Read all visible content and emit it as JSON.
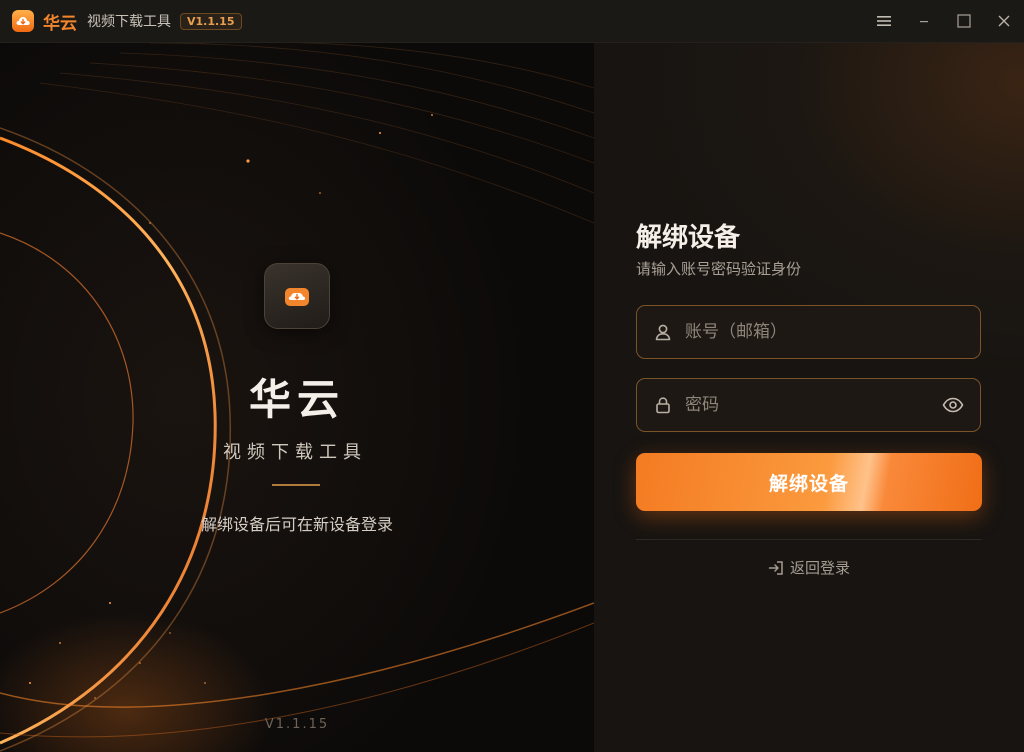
{
  "titlebar": {
    "brand": "华云",
    "subtitle": "视频下载工具",
    "version": "V1.1.15",
    "icons": {
      "app": "cloud-download-icon",
      "menu": "menu-icon",
      "minimize": "minimize-icon",
      "maximize": "maximize-icon",
      "close": "close-icon"
    }
  },
  "hero": {
    "title": "华云",
    "subtitle": "视频下载工具",
    "description": "解绑设备后可在新设备登录",
    "version": "V1.1.15"
  },
  "form": {
    "title": "解绑设备",
    "subtitle": "请输入账号密码验证身份",
    "account": {
      "placeholder": "账号（邮箱）",
      "value": "",
      "icon": "user-icon"
    },
    "password": {
      "placeholder": "密码",
      "value": "",
      "icon": "lock-icon",
      "toggle_icon": "eye-icon"
    },
    "submit_label": "解绑设备",
    "back_label": "返回登录",
    "back_icon": "sign-in-icon"
  },
  "colors": {
    "accent": "#f3862c",
    "background": "#16130f",
    "text": "#f5efe7"
  }
}
